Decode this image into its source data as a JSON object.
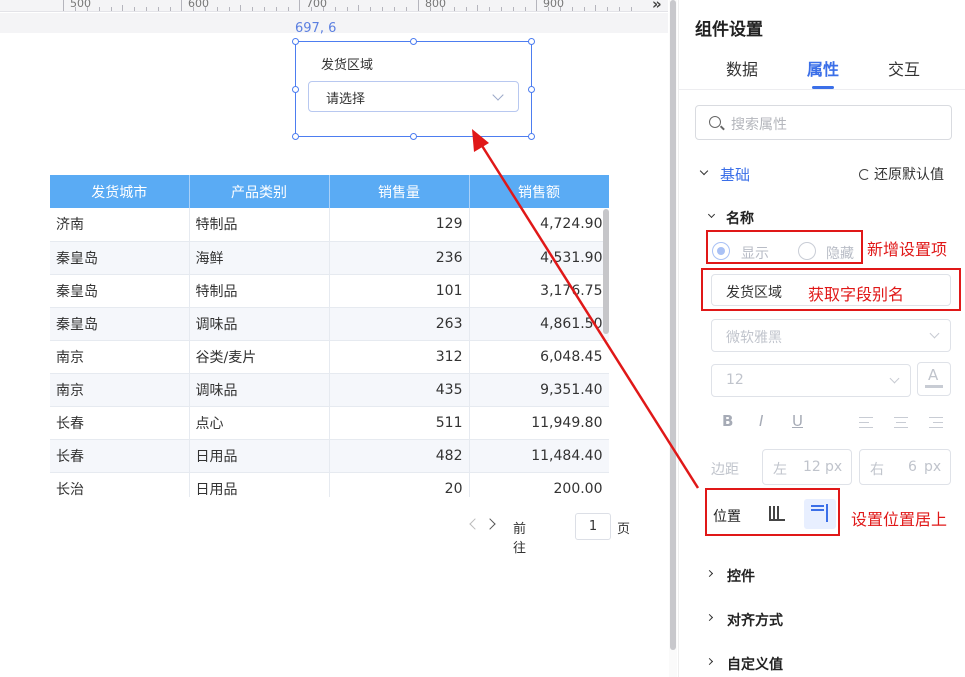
{
  "ruler": {
    "labels": [
      "500",
      "600",
      "700",
      "800",
      "900"
    ],
    "collapse_icon": "double-chevron-right-icon"
  },
  "widget": {
    "coordinate_readout": "697, 6",
    "label": "发货区域",
    "select_placeholder": "请选择"
  },
  "table": {
    "headers": [
      "发货城市",
      "产品类别",
      "销售量",
      "销售额"
    ],
    "rows": [
      [
        "济南",
        "特制品",
        "129",
        "4,724.90"
      ],
      [
        "秦皇岛",
        "海鲜",
        "236",
        "4,531.90"
      ],
      [
        "秦皇岛",
        "特制品",
        "101",
        "3,176.75"
      ],
      [
        "秦皇岛",
        "调味品",
        "263",
        "4,861.50"
      ],
      [
        "南京",
        "谷类/麦片",
        "312",
        "6,048.45"
      ],
      [
        "南京",
        "调味品",
        "435",
        "9,351.40"
      ],
      [
        "长春",
        "点心",
        "511",
        "11,949.80"
      ],
      [
        "长春",
        "日用品",
        "482",
        "11,484.40"
      ],
      [
        "长治",
        "日用品",
        "20",
        "200.00"
      ]
    ],
    "header_color": "#5aabf4"
  },
  "pager": {
    "goto_label": "前往",
    "page": "1",
    "page_suffix": "页"
  },
  "panel": {
    "title": "组件设置",
    "tabs": [
      "数据",
      "属性",
      "交互"
    ],
    "active_tab": "属性",
    "search_placeholder": "搜索属性",
    "section_basic": "基础",
    "restore_label": "还原默认值",
    "name_section": "名称",
    "radio_show": "显示",
    "radio_hide": "隐藏",
    "name_value": "发货区域",
    "font_family": "微软雅黑",
    "font_size": "12",
    "font_color_icon": "A",
    "bold": "B",
    "italic": "I",
    "underline": "U",
    "margin_label": "边距",
    "margin_left_label": "左",
    "margin_left_value": "12",
    "margin_right_label": "右",
    "margin_right_value": "6",
    "unit": "px",
    "position_label": "位置",
    "section_control": "控件",
    "section_align": "对齐方式",
    "section_custom": "自定义值",
    "accent_color": "#3b6fe8"
  },
  "annotations": {
    "new_setting": "新增设置项",
    "get_alias": "获取字段别名",
    "set_position_top": "设置位置居上",
    "color": "#e01818"
  }
}
